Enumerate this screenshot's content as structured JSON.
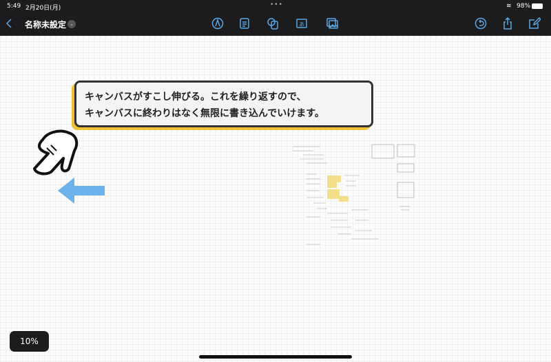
{
  "status_bar": {
    "time": "5:49",
    "date": "2月20日(月)",
    "battery": "98%",
    "icons": [
      "wifi-icon",
      "battery-icon"
    ]
  },
  "toolbar": {
    "title": "名称未設定",
    "left_icons": [
      "back-icon",
      "chevron-down-icon"
    ],
    "center_icons": [
      "pen-icon",
      "note-icon",
      "shapes-icon",
      "text-icon",
      "image-icon"
    ],
    "right_icons": [
      "undo-icon",
      "share-icon",
      "compose-icon"
    ],
    "accent": "#5aa9e6"
  },
  "canvas": {
    "callout_lines": [
      "キャンバスがすこし伸びる。これを繰り返すので、",
      "キャンバスに終わりはなく無限に書き込んでいけます。"
    ],
    "callout_accent": "#f2c236",
    "arrow_color": "#6bb3ea",
    "icons": [
      "pointing-hand-icon",
      "left-arrow-icon"
    ]
  },
  "zoom_level": "10%"
}
